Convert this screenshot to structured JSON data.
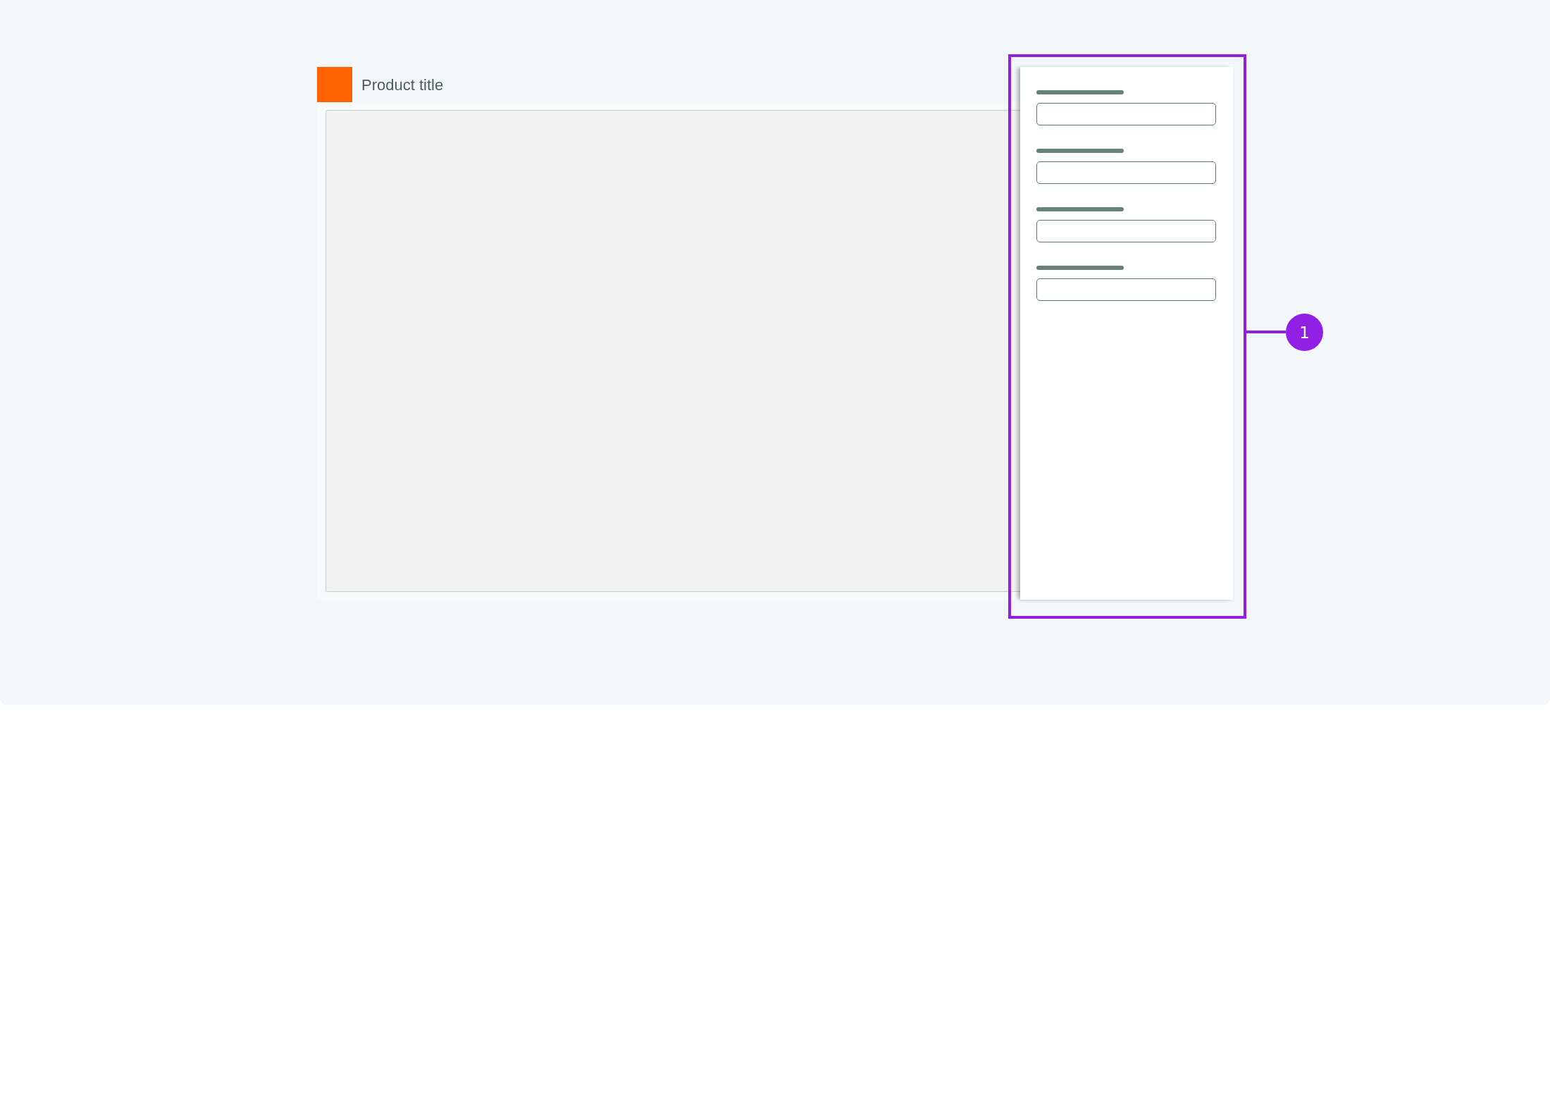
{
  "product": {
    "title": "Product title"
  },
  "side_panel": {
    "fields": [
      {
        "kind": "text_input"
      },
      {
        "kind": "text_input"
      },
      {
        "kind": "text_input"
      },
      {
        "kind": "text_input"
      }
    ]
  },
  "callout": {
    "label": "1"
  }
}
